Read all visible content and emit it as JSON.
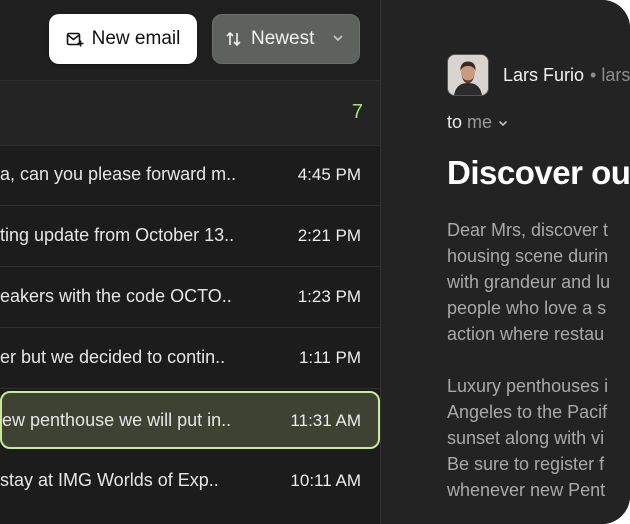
{
  "toolbar": {
    "new_email_label": "New email",
    "sort_label": "Newest"
  },
  "list": {
    "count": "7",
    "messages": [
      {
        "snippet": "a, can you please forward m..",
        "time": "4:45 PM"
      },
      {
        "snippet": "ting update from October 13..",
        "time": "2:21 PM"
      },
      {
        "snippet": "eakers with the code OCTO..",
        "time": "1:23 PM"
      },
      {
        "snippet": "er but we decided to contin..",
        "time": "1:11 PM"
      },
      {
        "snippet": "ew penthouse we will put in..",
        "time": "11:31 AM"
      },
      {
        "snippet": "stay at IMG Worlds of Exp..",
        "time": "10:11 AM"
      }
    ]
  },
  "email": {
    "sender_name": "Lars Furio",
    "sender_email": "• lars",
    "to_label": "to",
    "to_value": "me",
    "subject": "Discover ou",
    "paragraphs": [
      [
        "Dear Mrs, discover t",
        "housing scene durin",
        "with grandeur and lu",
        "people who love a s",
        "action where restau"
      ],
      [
        "Luxury penthouses i",
        "Angeles to the Pacif",
        "sunset along with vi",
        "Be sure to register f",
        "whenever new Pent"
      ]
    ]
  },
  "colors": {
    "accent_green": "#9ee27a",
    "selected_border": "#c8e89a"
  }
}
